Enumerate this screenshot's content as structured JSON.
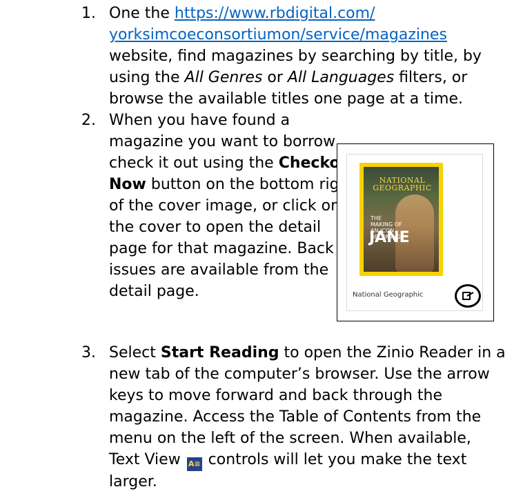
{
  "steps": [
    {
      "number": "1.",
      "line1_text": "One the ",
      "link_part1": "https://www.rbdigital.com/",
      "link_part2": "yorksimcoeconsortiumon/service/magazines",
      "line3": "website, find magazines by searching by title, by",
      "line4_a": "using the ",
      "line4_b": "All Genres",
      "line4_c": " or ",
      "line4_d": "All Languages",
      "line4_e": " filters, or",
      "line5": "browse the available titles one page at a time."
    },
    {
      "number": "2.",
      "line1": "When you have found a",
      "line2": "magazine you want to borrow,",
      "line3_a": "check it out using the ",
      "line3_b": "Checkout",
      "line4_a": "Now",
      "line4_b": " button on the bottom right",
      "line5": "of the cover image, or click on",
      "line6": "the cover to open the detail",
      "line7": "page for that magazine.  Back",
      "line8": "issues are available from the",
      "line9": "detail page."
    },
    {
      "number": "3.",
      "line1_a": "Select ",
      "line1_b": "Start Reading",
      "line1_c": " to open the Zinio Reader in a",
      "line2": "new tab of the computer’s browser. Use the arrow",
      "line3": "keys to move forward and back through the",
      "line4": "magazine.  Access the Table of Contents from the",
      "line5": "menu on the left of the screen. When available,",
      "line6_a": "Text View ",
      "line6_b": " controls will let you make the text",
      "line7": "larger."
    }
  ],
  "figure": {
    "cover_title": "NATIONAL GEOGRAPHIC",
    "cover_subtitle": "THE MAKING OF AN ICON BECOMING",
    "cover_headline": "JANE",
    "caption": "National Geographic",
    "checkout_icon": "checkout-icon"
  },
  "icons": {
    "text_view": "text-view-icon"
  },
  "colors": {
    "link": "#0563c1",
    "cover_border": "#f6d200"
  }
}
